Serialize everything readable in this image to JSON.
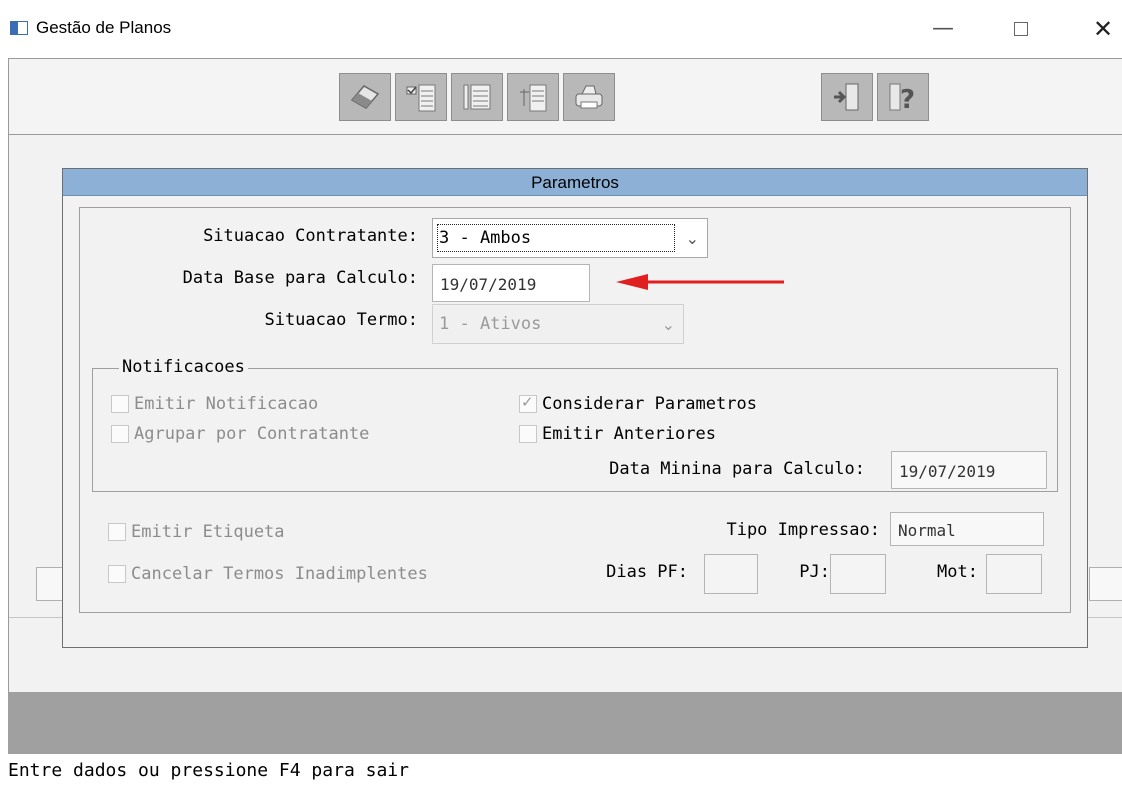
{
  "window": {
    "title": "Gestão de Planos",
    "minimize_glyph": "—",
    "close_glyph": "✕"
  },
  "toolbar": {
    "buttons": [
      {
        "icon": "eraser-icon"
      },
      {
        "icon": "checklist-icon"
      },
      {
        "icon": "list-icon"
      },
      {
        "icon": "tree-list-icon"
      },
      {
        "icon": "printer-icon"
      },
      {
        "icon": "exit-door-icon"
      },
      {
        "icon": "help-icon"
      }
    ]
  },
  "dialog": {
    "title": "Parametros",
    "situacao_contratante": {
      "label": "Situacao Contratante:",
      "value": "3 - Ambos"
    },
    "data_base": {
      "label": "Data Base para Calculo:",
      "value": "19/07/2019"
    },
    "situacao_termo": {
      "label": "Situacao Termo:",
      "value": "1 - Ativos"
    },
    "notificacoes": {
      "legend": "Notificacoes",
      "emitir_notificacao": {
        "label": "Emitir Notificacao",
        "checked": false
      },
      "agrupar_contratante": {
        "label": "Agrupar por Contratante",
        "checked": false
      },
      "considerar_parametros": {
        "label": "Considerar Parametros",
        "checked": true
      },
      "emitir_anteriores": {
        "label": "Emitir Anteriores",
        "checked": false
      },
      "data_minina": {
        "label": "Data Minina para Calculo:",
        "value": "19/07/2019"
      }
    },
    "emitir_etiqueta": {
      "label": "Emitir Etiqueta",
      "checked": false
    },
    "cancelar_termos": {
      "label": "Cancelar Termos Inadimplentes",
      "checked": false
    },
    "tipo_impressao": {
      "label": "Tipo Impressao:",
      "value": "Normal"
    },
    "dias_pf": {
      "label": "Dias PF:",
      "value": ""
    },
    "pj": {
      "label": "PJ:",
      "value": ""
    },
    "mot": {
      "label": "Mot:",
      "value": ""
    }
  },
  "status_bar": {
    "text": "Entre dados ou pressione F4 para sair"
  },
  "colors": {
    "dialog_title_bg": "#8db1d6",
    "annotation_arrow": "#e02020",
    "toolbar_button_bg": "#b8b8b8",
    "bottom_bar_bg": "#a0a0a0"
  }
}
